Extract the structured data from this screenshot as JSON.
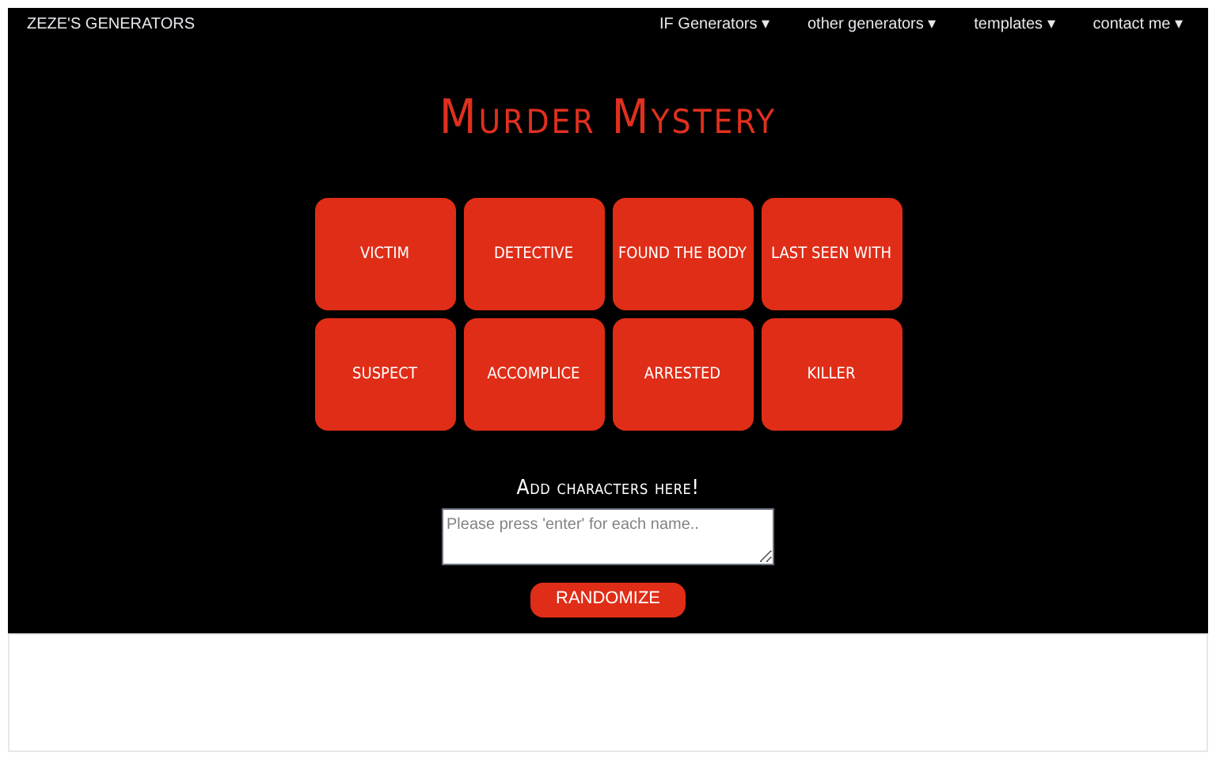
{
  "nav": {
    "brand": "ZEZE'S GENERATORS",
    "menus": [
      {
        "label": "IF Generators ▾"
      },
      {
        "label": "other generators ▾"
      },
      {
        "label": "templates ▾"
      },
      {
        "label": "contact me ▾"
      }
    ]
  },
  "title": "Murder Mystery",
  "roles": [
    "VICTIM",
    "DETECTIVE",
    "FOUND THE BODY",
    "LAST SEEN WITH",
    "SUSPECT",
    "ACCOMPLICE",
    "ARRESTED",
    "KILLER"
  ],
  "input": {
    "label": "Add characters here!",
    "placeholder": "Please press 'enter' for each name.."
  },
  "button": "RANDOMIZE"
}
